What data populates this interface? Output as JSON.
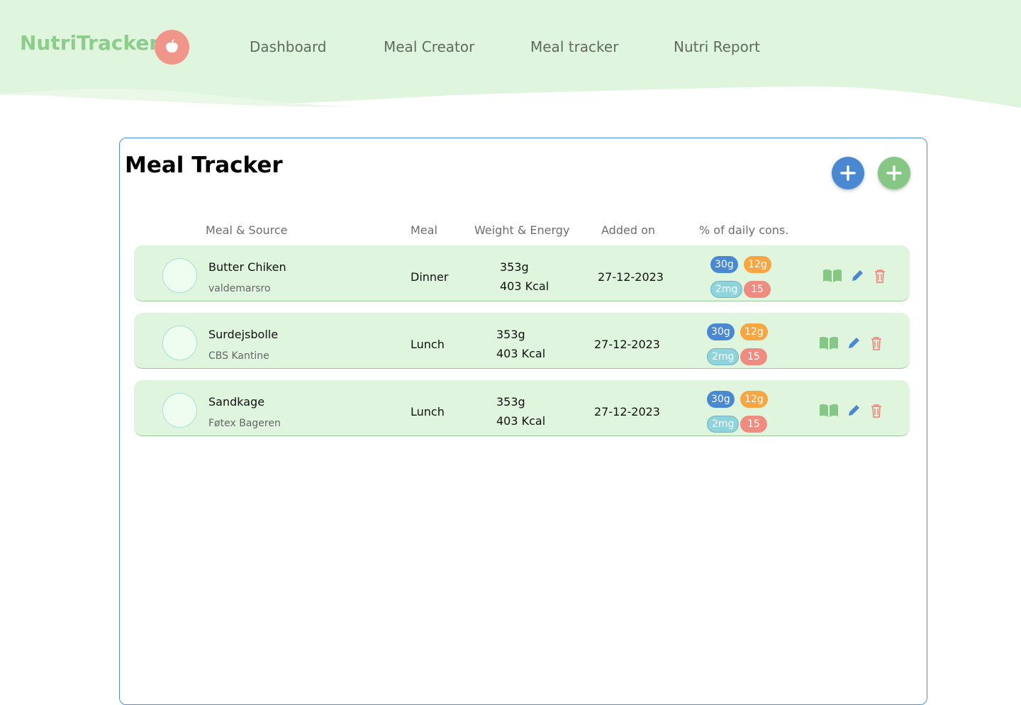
{
  "brand": {
    "name": "NutriTracker",
    "icon": "apple-icon"
  },
  "nav": [
    {
      "label": "Dashboard"
    },
    {
      "label": "Meal Creator"
    },
    {
      "label": "Meal tracker"
    },
    {
      "label": "Nutri Report"
    }
  ],
  "page": {
    "title": "Meal Tracker",
    "buttons": {
      "add_blue": "plus-icon",
      "add_green": "plus-icon"
    }
  },
  "table": {
    "headers": {
      "meal_source": "Meal & Source",
      "meal": "Meal",
      "weight_energy": "Weight & Energy",
      "added_on": "Added on",
      "daily": "% of daily cons."
    },
    "rows": [
      {
        "name": "Butter Chiken",
        "source": "valdemarsro",
        "meal": "Dinner",
        "weight": "353g",
        "energy": "403 Kcal",
        "added": "27-12-2023",
        "pills": [
          "30g",
          "12g",
          "2mg",
          "15"
        ]
      },
      {
        "name": "Surdejsbolle",
        "source": "CBS Kantine",
        "meal": "Lunch",
        "weight": "353g",
        "energy": "403 Kcal",
        "added": "27-12-2023",
        "pills": [
          "30g",
          "12g",
          "2mg",
          "15"
        ]
      },
      {
        "name": "Sandkage",
        "source": "Føtex Bageren",
        "meal": "Lunch",
        "weight": "353g",
        "energy": "403 Kcal",
        "added": "27-12-2023",
        "pills": [
          "30g",
          "12g",
          "2mg",
          "15"
        ]
      }
    ]
  },
  "colors": {
    "header_bg": "#e0f5de",
    "brand": "#8ccd8c",
    "blue": "#4a89d2",
    "green": "#86c786",
    "orange": "#f7a644",
    "red": "#ee8c82"
  }
}
